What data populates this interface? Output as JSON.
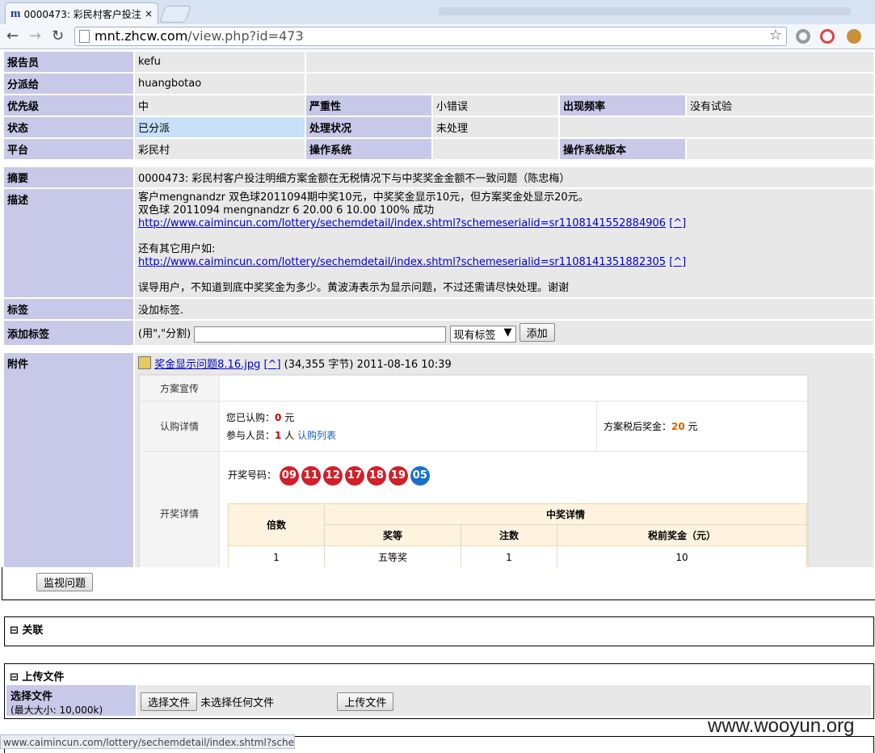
{
  "browser": {
    "tab_title": "0000473: 彩民村客户投注",
    "tab_close": "×",
    "url_host": "mnt.zhcw.com",
    "url_path": "/view.php?id=473",
    "status_url": "www.caimincun.com/lottery/sechemdetail/index.shtml?sche..."
  },
  "fields": {
    "reporter_label": "报告员",
    "reporter": "kefu",
    "assignee_label": "分派给",
    "assignee": "huangbotao",
    "priority_label": "优先级",
    "priority": "中",
    "severity_label": "严重性",
    "severity": "小错误",
    "frequency_label": "出现频率",
    "frequency": "没有试验",
    "status_label": "状态",
    "status": "已分派",
    "resolution_label": "处理状况",
    "resolution": "未处理",
    "platform_label": "平台",
    "platform": "彩民村",
    "os_label": "操作系统",
    "os": "",
    "os_version_label": "操作系统版本",
    "os_version": ""
  },
  "summary_label": "摘要",
  "summary": "0000473: 彩民村客户投注明细方案金额在无税情况下与中奖奖金金额不一致问题（陈忠梅）",
  "description_label": "描述",
  "description": {
    "line1": "客户mengnandzr 双色球2011094期中奖10元，中奖奖金显示10元，但方案奖金处显示20元。",
    "line2": "双色球 2011094 mengnandzr 6 20.00 6 10.00 100% 成功",
    "link1": "http://www.caimincun.com/lottery/sechemdetail/index.shtml?schemeserialid=sr1108141552884906",
    "caret1": "[^]",
    "line3": "还有其它用户如:",
    "link2": "http://www.caimincun.com/lottery/sechemdetail/index.shtml?schemeserialid=sr1108141351882305",
    "caret2": "[^]",
    "line4": "误导用户，不知道到底中奖奖金为多少。黄波涛表示为显示问题，不过还需请尽快处理。谢谢"
  },
  "tags_label": "标签",
  "tags_value": "没加标签.",
  "add_tag_label": "添加标签",
  "add_tag_hint": "(用\",\"分割)",
  "tag_select": "现有标签",
  "add_button": "添加",
  "attachment_label": "附件",
  "attachment": {
    "filename": "奖金显示问题8.16.jpg",
    "caret": "[^]",
    "meta": "(34,355 字节) 2011-08-16 10:39"
  },
  "attachment_image": {
    "row1_label": "方案宣传",
    "row2_label": "认购详情",
    "subscribed_prefix": "您已认购：",
    "subscribed_amount": "0",
    "unit_yuan": "元",
    "participants_prefix": "参与人员：",
    "participants_count": "1",
    "unit_person": "人",
    "subscribe_list": "认购列表",
    "after_tax_label": "方案税后奖金：",
    "after_tax_amount": "20",
    "after_tax_unit": "元",
    "row3_label": "开奖详情",
    "draw_label": "开奖号码：",
    "red_balls": [
      "09",
      "11",
      "12",
      "17",
      "18",
      "19"
    ],
    "blue_ball": "05",
    "table_multiple": "倍数",
    "table_prize_header": "中奖详情",
    "table_level": "奖等",
    "table_count": "注数",
    "table_pretax": "税前奖金（元）",
    "row_multiple": "1",
    "row_level": "五等奖",
    "row_count": "1",
    "row_pretax": "10"
  },
  "monitor_button": "监视问题",
  "relations_title": "⊟ 关联",
  "upload_title": "⊟ 上传文件",
  "upload_label": "选择文件",
  "upload_max": "(最大大小: 10,000k)",
  "choose_file_button": "选择文件",
  "no_file_text": "未选择任何文件",
  "upload_button": "上传文件",
  "watermark": "www.wooyun.org",
  "colors": {
    "label_bg": "#c8c8e8",
    "value_bg": "#e8e8e8",
    "status_bg": "#c8e0f8",
    "red_ball": "#d0202a",
    "blue_ball": "#1a70c8"
  }
}
